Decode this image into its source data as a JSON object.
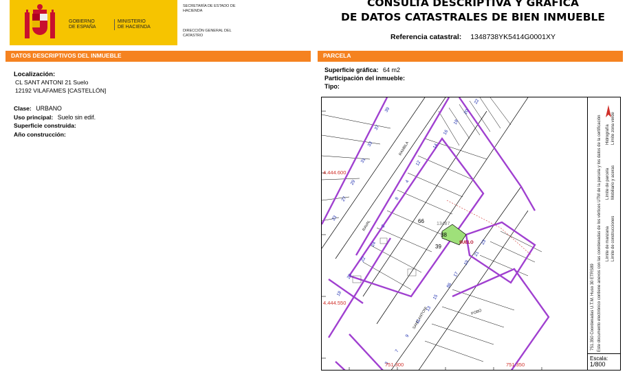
{
  "header": {
    "gobierno": "GOBIERNO\nDE ESPAÑA",
    "ministerio": "MINISTERIO\nDE HACIENDA",
    "secretaria": "SECRETARÍA DE ESTADO DE HACIENDA",
    "direccion": "DIRECCIÓN GENERAL DEL CATASTRO",
    "title_line1": "CONSULTA DESCRIPTIVA Y GRÁFICA",
    "title_line2": "DE DATOS CATASTRALES DE BIEN INMUEBLE",
    "ref_label": "Referencia catastral:",
    "ref_value": "1348738YK5414G0001XY"
  },
  "left": {
    "section_title": "DATOS DESCRIPTIVOS DEL INMUEBLE",
    "localizacion_label": "Localización:",
    "localizacion_line1": "CL SANT ANTONI 21 Suelo",
    "localizacion_line2": "12192 VILAFAMES [CASTELLÓN]",
    "clase_label": "Clase:",
    "clase_value": "URBANO",
    "uso_label": "Uso principal:",
    "uso_value": "Suelo sin edif.",
    "superficie_label": "Superficie construida:",
    "superficie_value": "",
    "anio_label": "Año construcción:",
    "anio_value": ""
  },
  "right": {
    "section_title": "PARCELA",
    "superficie_label": "Superficie gráfica:",
    "superficie_value": "64 m2",
    "participacion_label": "Participación del inmueble:",
    "participacion_value": "",
    "tipo_label": "Tipo:",
    "tipo_value": ""
  },
  "map": {
    "coord_y1": "4.444.600",
    "coord_y2": "4.444.550",
    "coord_x1": "751.300",
    "coord_x2": "751.350",
    "street_raval": "RAVAL",
    "street_rambla": "RAMBLA",
    "street_antoni": "SANT ANTONI",
    "street_pobo": "POBO",
    "label_66": "66",
    "label_38": "38",
    "label_39": "39",
    "label_suelo": "SUELO",
    "parcel_ref": "13487"
  },
  "legend": {
    "limite_manzana": "Límite de manzana",
    "limite_parcela": "Límite de parcela",
    "limite_construcciones": "Límite de construcciones",
    "mobiliario": "Mobiliario y aceras",
    "hidrografia": "Hidrografía",
    "zona_verde": "Límite zona verde",
    "coordenadas": "751.350 Coordenadas U.T.M. Huso 30 ETRS89",
    "documento": "Este documento electrónico contiene anexos con las coordenadas de los vértices UTM de la parcela y los datos de la certificación",
    "escala_label": "Escala:",
    "escala_value": "1/800"
  },
  "colors": {
    "orange": "#f58220",
    "gov_yellow": "#f6c400",
    "manzana_purple": "#a040d0",
    "highlight_green": "#9fe07a",
    "coord_red": "#d0302a"
  }
}
